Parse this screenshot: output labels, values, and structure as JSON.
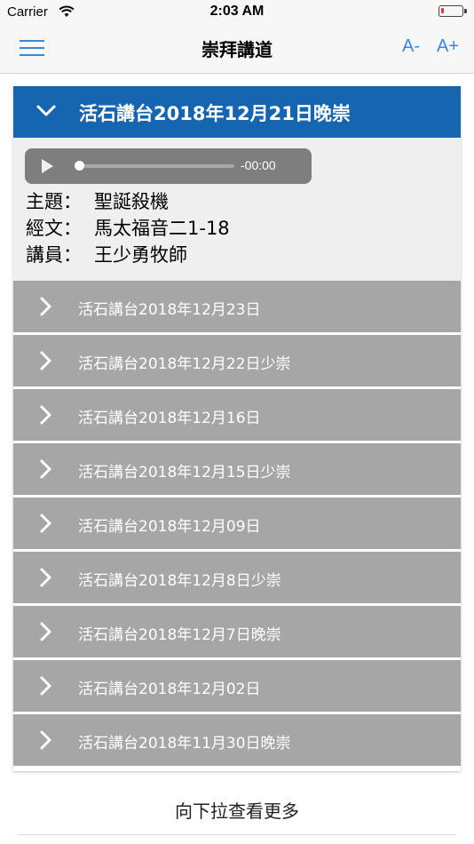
{
  "status_bar": {
    "carrier": "Carrier",
    "time": "2:03 AM"
  },
  "nav": {
    "title": "崇拜講道",
    "font_smaller": "A-",
    "font_larger": "A+"
  },
  "current": {
    "title": "活石講台2018年12月21日晚崇",
    "player_time": "-00:00",
    "topic_label": "主題：",
    "topic": "聖誕殺機",
    "scripture_label": "經文：",
    "scripture": "馬太福音二1-18",
    "speaker_label": "講員：",
    "speaker": "王少勇牧師"
  },
  "items": [
    {
      "label": "活石講台2018年12月23日"
    },
    {
      "label": "活石講台2018年12月22日少崇"
    },
    {
      "label": "活石講台2018年12月16日"
    },
    {
      "label": "活石講台2018年12月15日少崇"
    },
    {
      "label": "活石講台2018年12月09日"
    },
    {
      "label": "活石講台2018年12月8日少崇"
    },
    {
      "label": "活石講台2018年12月7日晚崇"
    },
    {
      "label": "活石講台2018年12月02日"
    },
    {
      "label": "活石講台2018年11月30日晚崇"
    }
  ],
  "pull_to_load": "向下拉查看更多",
  "colors": {
    "accent": "#1565b0",
    "nav_tint": "#3a87d8",
    "collapsed_item": "#a6a6a6"
  }
}
